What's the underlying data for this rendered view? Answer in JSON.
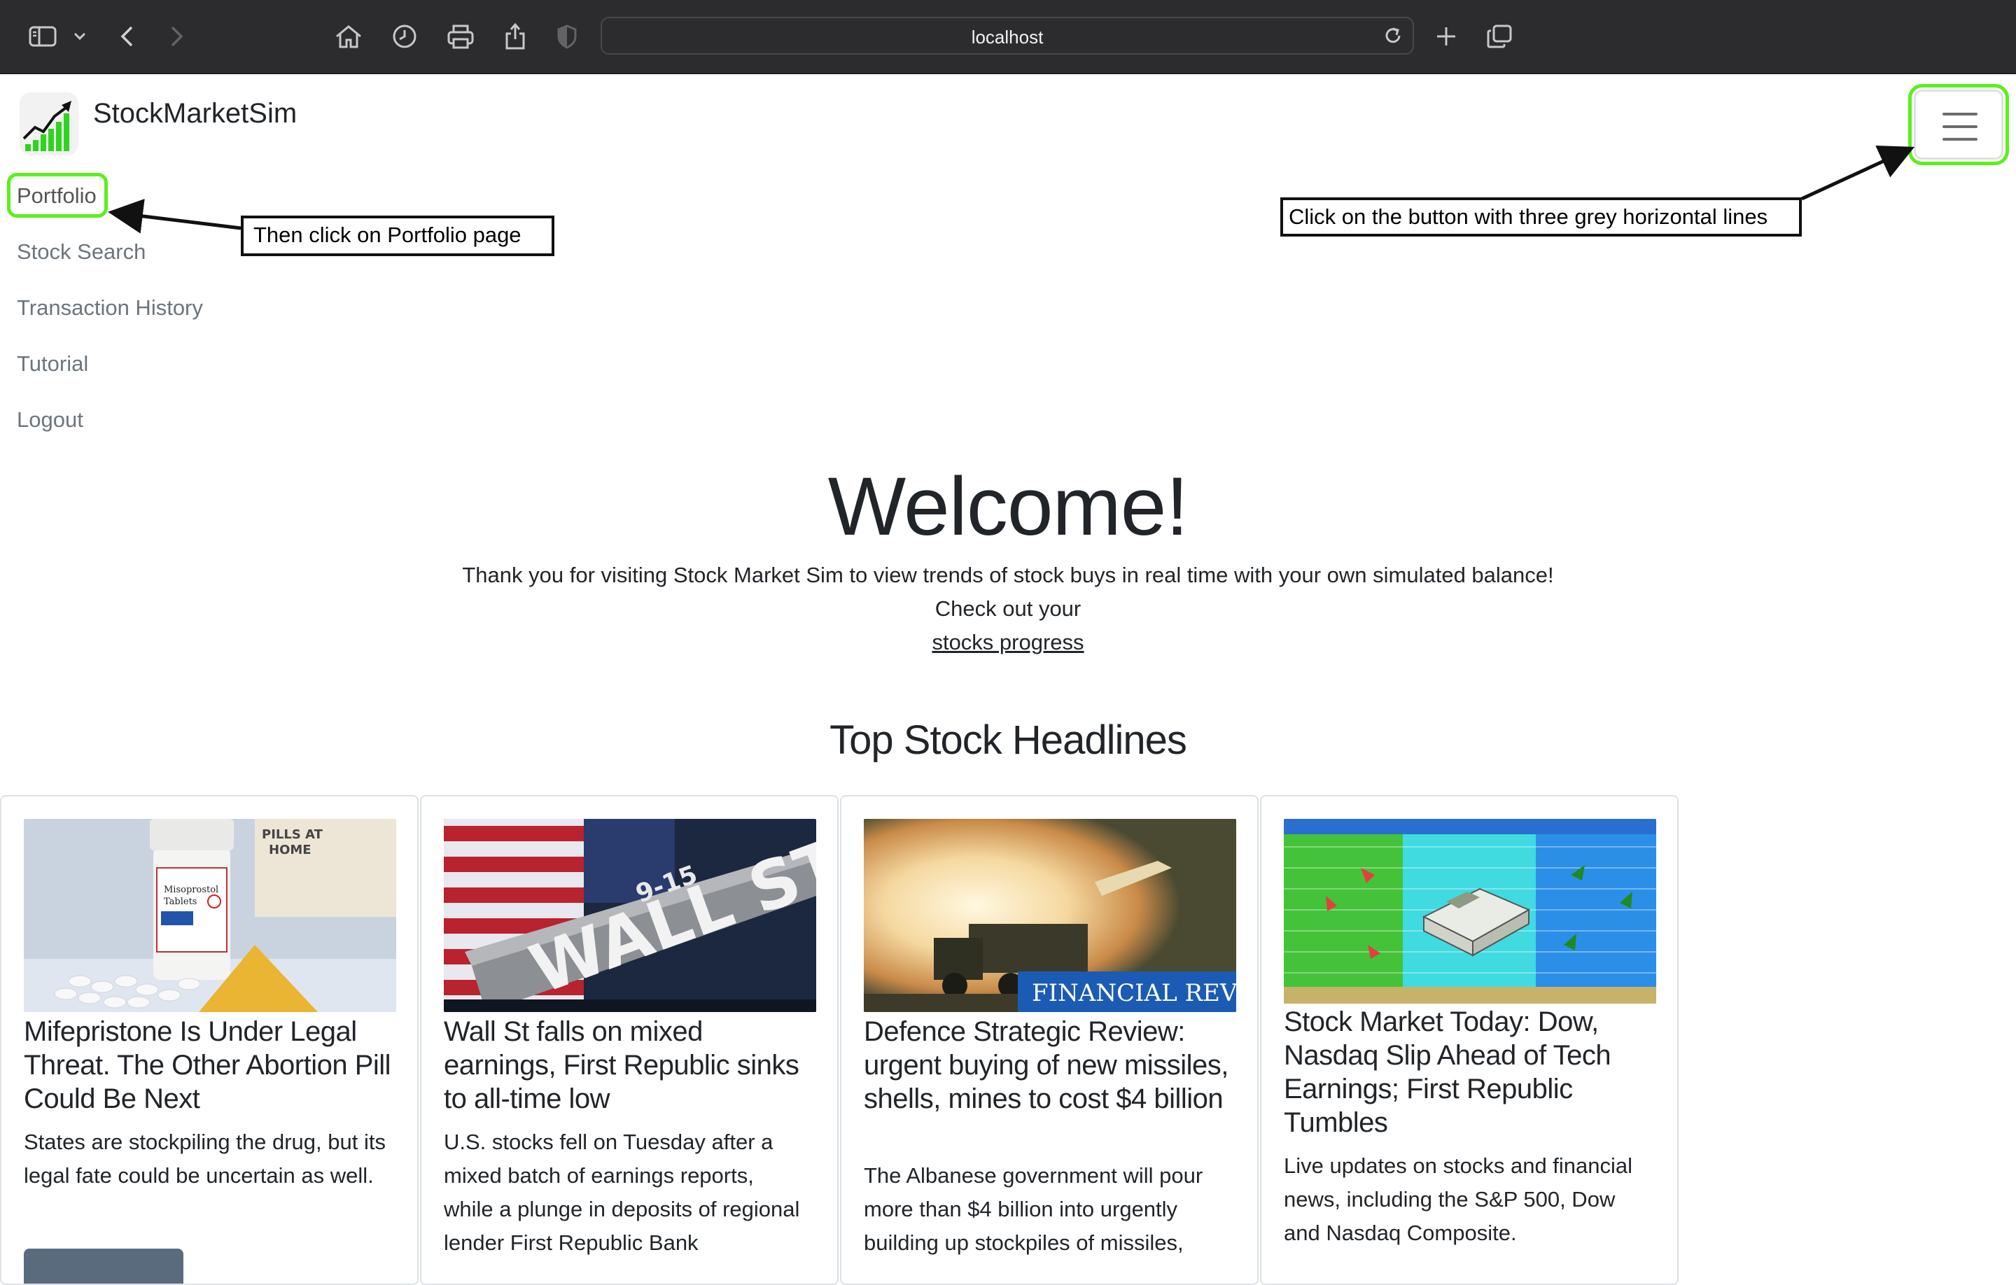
{
  "browser": {
    "address": "localhost",
    "icons": [
      "sidebar-icon",
      "chevron-down-icon",
      "back-icon",
      "forward-icon",
      "home-icon",
      "history-icon",
      "print-icon",
      "share-icon",
      "shield-icon",
      "reload-icon",
      "new-tab-icon",
      "tabs-overview-icon"
    ]
  },
  "navbar": {
    "brand": "StockMarketSim",
    "menu_icon": "hamburger-icon",
    "links": [
      "Portfolio",
      "Stock Search",
      "Transaction History",
      "Tutorial",
      "Logout"
    ]
  },
  "annotations": {
    "portfolio_hint": "Then click on Portfolio page",
    "toggler_hint": "Click on the button with three grey horizontal lines",
    "highlight_color": "#5cf01a"
  },
  "hero": {
    "title": "Welcome!",
    "line1": "Thank you for visiting Stock Market Sim to view trends of stock buys in real time with your own simulated balance!",
    "line2": "Check out your",
    "link": "stocks progress"
  },
  "headlines": {
    "title": "Top Stock Headlines",
    "cards": [
      {
        "title": "Mifepristone Is Under Legal Threat. The Other Abortion Pill Could Be Next",
        "text": "States are stockpiling the drug, but its legal fate could be uncertain as well.",
        "image": "pill-bottle-image"
      },
      {
        "title": "Wall St falls on mixed earnings, First Republic sinks to all-time low",
        "text": "U.S. stocks fell on Tuesday after a mixed batch of earnings reports, while a plunge in deposits of regional lender First Republic Bank",
        "image": "wall-street-sign-image",
        "image_sign": "WALL ST",
        "image_sign_small": "9-15"
      },
      {
        "title": "Defence Strategic Review: urgent buying of new missiles, shells, mines to cost $4 billion",
        "text": "The Albanese government will pour more than $4 billion into urgently building up stockpiles of missiles,",
        "image": "missile-launch-image",
        "image_caption": "FINANCIAL REVIEW"
      },
      {
        "title": "Stock Market Today: Dow, Nasdaq Slip Ahead of Tech Earnings; First Republic Tumbles",
        "text": "Live updates on stocks and financial news, including the S&P 500, Dow and Nasdaq Composite.",
        "image": "money-stack-image"
      }
    ]
  }
}
